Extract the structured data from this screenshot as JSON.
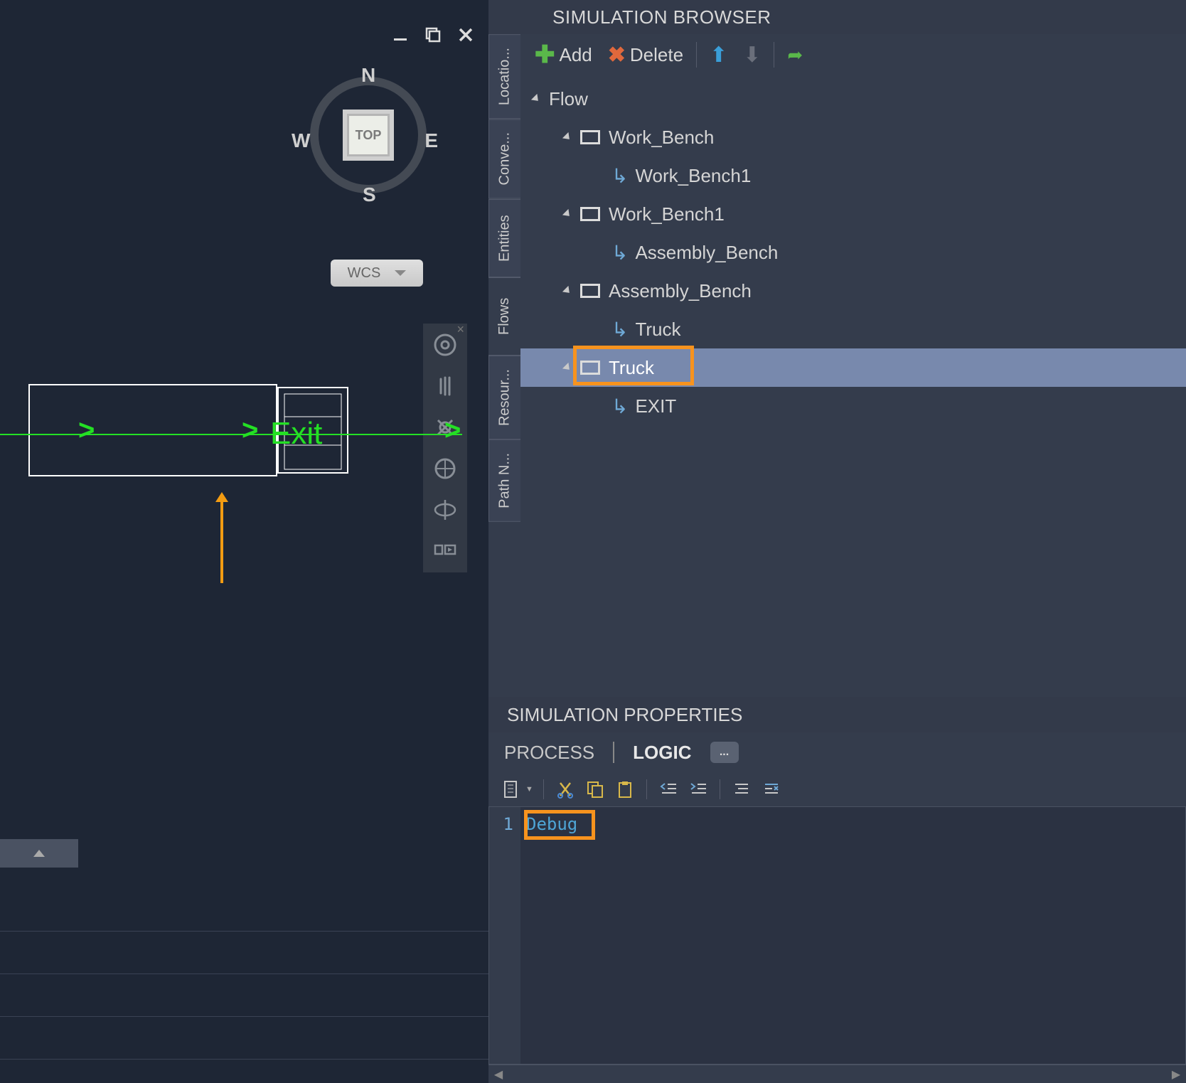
{
  "compass": {
    "n": "N",
    "s": "S",
    "e": "E",
    "w": "W",
    "top": "TOP"
  },
  "wcs": {
    "label": "WCS"
  },
  "viewport": {
    "exit_label": "Exit"
  },
  "browser": {
    "title": "SIMULATION BROWSER",
    "side_tabs": [
      "Locatio...",
      "Conve...",
      "Entities",
      "Flows",
      "Resour...",
      "Path N..."
    ],
    "active_side_tab": 3,
    "toolbar": {
      "add": "Add",
      "delete": "Delete"
    },
    "tree": {
      "root": "Flow",
      "items": [
        {
          "label": "Work_Bench",
          "child": "Work_Bench1"
        },
        {
          "label": "Work_Bench1",
          "child": "Assembly_Bench"
        },
        {
          "label": "Assembly_Bench",
          "child": "Truck"
        },
        {
          "label": "Truck",
          "child": "EXIT",
          "selected": true
        }
      ]
    }
  },
  "properties": {
    "title": "SIMULATION PROPERTIES",
    "tabs": {
      "process": "PROCESS",
      "logic": "LOGIC",
      "more": "..."
    },
    "code": {
      "line_num": "1",
      "text": "Debug"
    }
  }
}
